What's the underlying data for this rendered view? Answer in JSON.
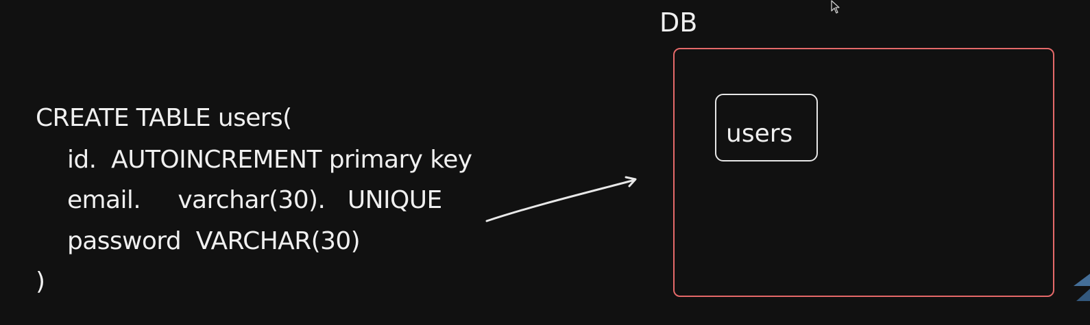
{
  "sql": {
    "line1": "CREATE TABLE users(",
    "line2": "id.  AUTOINCREMENT primary key",
    "line3": "email.     varchar(30).   UNIQUE",
    "line4": "password  VARCHAR(30)",
    "line5": ")"
  },
  "db": {
    "label": "DB",
    "table_label": "users"
  },
  "colors": {
    "background": "#111111",
    "db_border": "#e66a6a",
    "text": "#f0f0f0"
  },
  "icons": [
    "arrow-icon",
    "cursor-icon",
    "corner-logo-icon"
  ]
}
